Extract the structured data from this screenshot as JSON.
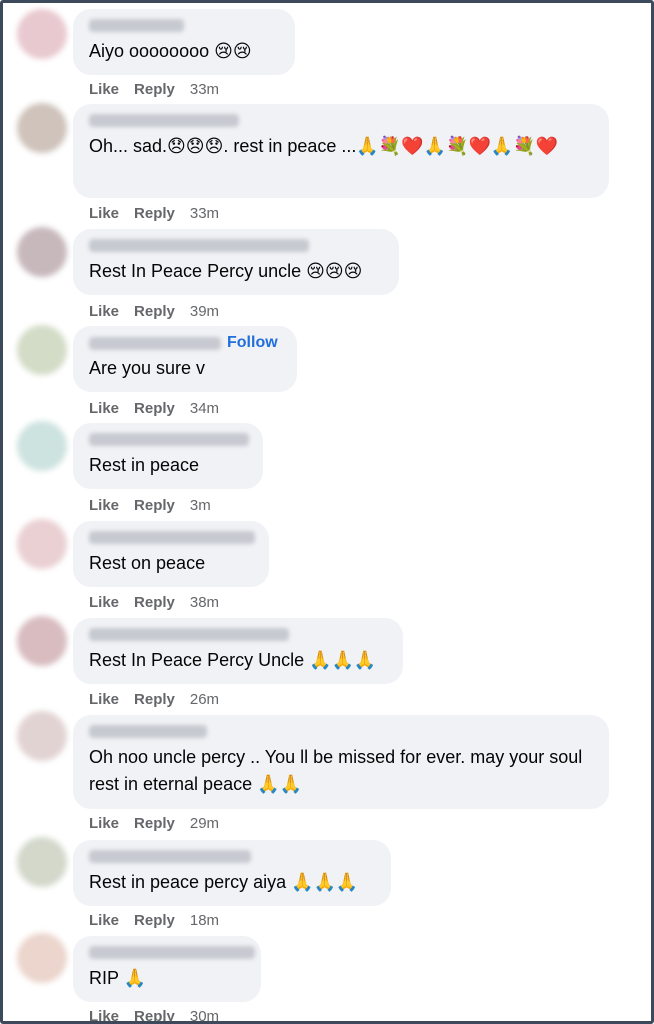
{
  "ui": {
    "like_label": "Like",
    "reply_label": "Reply",
    "follow_label": "Follow"
  },
  "comments": [
    {
      "text": "Aiyo oooooooo 😢😢",
      "time": "33m",
      "avatar_color": "#e8c9cf"
    },
    {
      "text": "Oh... sad.😞😞😞. rest in peace ...🙏💐❤️🙏💐❤️🙏💐❤️",
      "time": "33m",
      "avatar_color": "#cfc3bb"
    },
    {
      "text": "Rest In Peace Percy uncle 😢😢😢",
      "time": "39m",
      "avatar_color": "#c7b8bc"
    },
    {
      "text": "Are you sure v",
      "time": "34m",
      "avatar_color": "#d3dcc7"
    },
    {
      "text": "Rest in peace",
      "time": "3m",
      "avatar_color": "#cde3df"
    },
    {
      "text": "Rest on peace",
      "time": "38m",
      "avatar_color": "#ead0d3"
    },
    {
      "text": "Rest In Peace Percy Uncle 🙏🙏🙏",
      "time": "26m",
      "avatar_color": "#d8bcc0"
    },
    {
      "text": "Oh noo uncle percy .. You ll be missed for ever. may your soul rest in eternal peace 🙏🙏",
      "time": "29m",
      "avatar_color": "#e2d3d3"
    },
    {
      "text": "Rest in peace percy aiya 🙏🙏🙏",
      "time": "18m",
      "avatar_color": "#d3d8cb"
    },
    {
      "text": "RIP 🙏",
      "time": "30m",
      "avatar_color": "#ebd5cc"
    }
  ]
}
